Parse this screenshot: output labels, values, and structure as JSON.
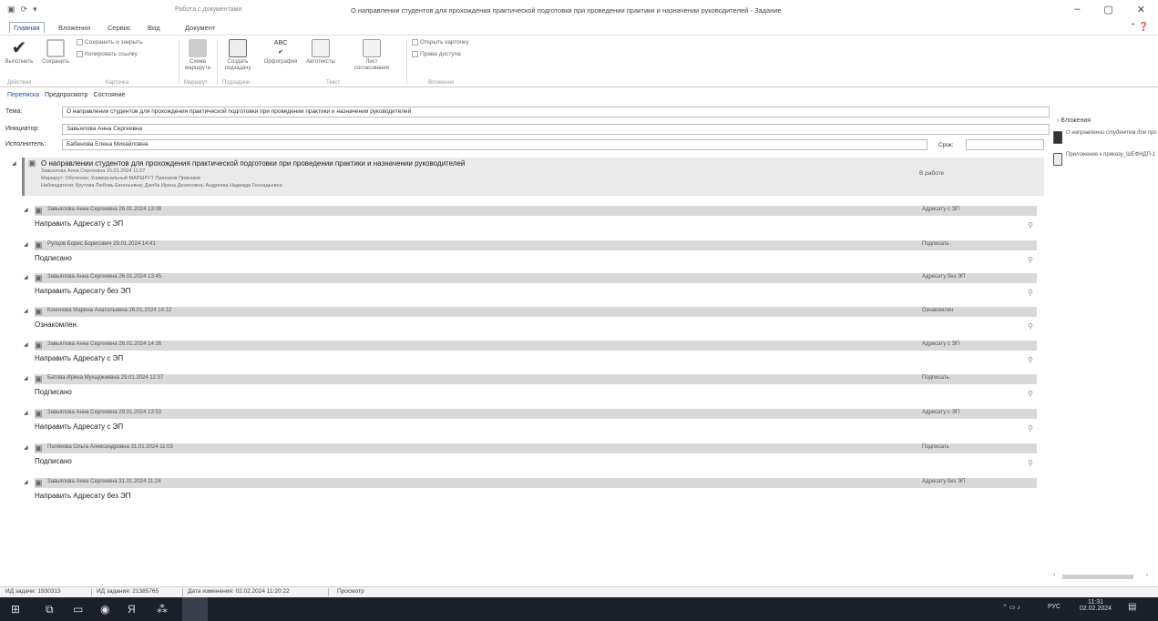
{
  "titlebar": {
    "context": "Работа с документами",
    "title": "О направлении студентов для прохождения практической подготовки при проведении практики и назначении руководителей - Задание"
  },
  "menu_tabs": [
    "Главная",
    "Вложения",
    "Сервис",
    "Вид",
    "Документ"
  ],
  "ribbon": {
    "execute": "Выполнить",
    "save": "Сохранить",
    "save_close": "Сохранить и закрыть",
    "copy_link": "Копировать ссылку",
    "route": "Схема маршрута",
    "create_subtask": "Создать подзадачу",
    "spelling": "Орфография",
    "autotexts": "Автотексты",
    "approval_sheet": "Лист согласования",
    "open_card": "Открыть карточку",
    "access_rights": "Права доступа",
    "groups": [
      "Действия",
      "Карточка",
      "Маршрут",
      "Подзадачи",
      "Текст",
      "Вложения"
    ]
  },
  "subtabs": [
    "Переписка",
    "Предпросмотр",
    "Состояние"
  ],
  "fields": {
    "subject_label": "Тема:",
    "subject": "О направлении студентов для прохождения практической подготовки при проведении практики и назначении руководителей",
    "initiator_label": "Инициатор:",
    "initiator": "Завьялова Анна Сергеевна",
    "executor_label": "Исполнитель:",
    "executor": "Бабенова Елена Михайловна",
    "deadline_label": "Срок:"
  },
  "root": {
    "title": "О направлении студентов для прохождения практической подготовки при проведении практики и назначении руководителей",
    "line1": "Завьялова Анна Сергеевна 26.01.2024 11:27",
    "line2": "Маршрут: Обучение; Универсальный МАРШРУТ Приказов Приказов",
    "line3": "Наблюдатели: Крутова Любовь Евгеньевна; Дзюба Ирина Денисовна; Андреева Надежда Геннадьевна",
    "status": "В работе"
  },
  "messages": [
    {
      "header": "Завьялова Анна Сергеевна 26.01.2024 13:08",
      "action": "Направить Адресату с ЭП",
      "status": "Адресату с ЭП"
    },
    {
      "header": "Рупцов Борис Борисович 29.01.2024 14:41",
      "action": "Подписано",
      "status": "Подписать"
    },
    {
      "header": "Завьялова Анна Сергеевна 26.01.2024 13:45",
      "action": "Направить Адресату без ЭП",
      "status": "Адресату без ЭП"
    },
    {
      "header": "Кононова Марина Анатольевна 26.01.2024 14:12",
      "action": "Ознакомлен.",
      "status": "Ознакомлен"
    },
    {
      "header": "Завьялова Анна Сергеевна 26.01.2024 14:26",
      "action": "Направить Адресату с ЭП",
      "status": "Адресату с ЭП"
    },
    {
      "header": "Батова Ирина Мухаджиевна 29.01.2024 12:37",
      "action": "Подписано",
      "status": "Подписать"
    },
    {
      "header": "Завьялова Анна Сергеевна 29.01.2024 13:53",
      "action": "Направить Адресату с ЭП",
      "status": "Адресату с ЭП"
    },
    {
      "header": "Полякова Ольга Александровна 31.01.2024 11:03",
      "action": "Подписано",
      "status": "Подписать"
    },
    {
      "header": "Завьялова Анна Сергеевна 31.01.2024 11:24",
      "action": "Направить Адресату без ЭП",
      "status": "Адресату без ЭП"
    }
  ],
  "attachments": {
    "header": "Вложения",
    "items": [
      "О направлении студентов для про",
      "Приложение к приказу_ШЕФНДП-1"
    ]
  },
  "statusbar": {
    "task_id": "ИД задачи: 1930313",
    "assignment_id": "ИД задания: 21385765",
    "modified": "Дата изменения: 02.02.2024 11:20:22",
    "mode": "Просмотр"
  },
  "tray": {
    "lang": "РУС",
    "time": "11:31",
    "date": "02.02.2024"
  }
}
